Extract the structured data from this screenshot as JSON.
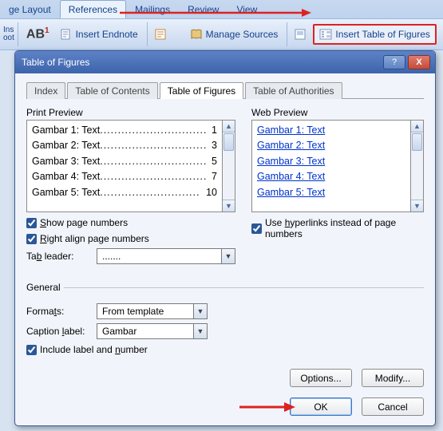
{
  "ribbon": {
    "tabs": [
      "ge Layout",
      "References",
      "Mailings",
      "Review",
      "View"
    ],
    "active_index": 1,
    "big_label": "AB",
    "insert_endnote": "Insert Endnote",
    "manage_sources": "Manage Sources",
    "insert_tof": "Insert Table of Figures",
    "left_stub": "Ins",
    "left_stub2": "oot"
  },
  "dialog": {
    "title": "Table of Figures",
    "help": "?",
    "close": "X",
    "tabs": {
      "index": "Index",
      "toc": "Table of Contents",
      "tof": "Table of Figures",
      "toa": "Table of Authorities"
    },
    "print_preview_label": "Print Preview",
    "web_preview_label": "Web Preview",
    "print_items": [
      {
        "label": "Gambar 1: Text",
        "page": "1"
      },
      {
        "label": "Gambar 2: Text",
        "page": "3"
      },
      {
        "label": "Gambar 3: Text",
        "page": "5"
      },
      {
        "label": "Gambar 4: Text",
        "page": "7"
      },
      {
        "label": "Gambar 5: Text",
        "page": "10"
      }
    ],
    "web_items": [
      "Gambar 1: Text",
      "Gambar 2: Text",
      "Gambar 3: Text",
      "Gambar 4: Text",
      "Gambar 5: Text"
    ],
    "chk_show_pages": "Show page numbers",
    "chk_right_align": "Right align page numbers",
    "chk_hyperlinks": "Use hyperlinks instead of page numbers",
    "tab_leader_label": "Tab leader:",
    "tab_leader_value": ".......",
    "general_label": "General",
    "formats_label": "Formats:",
    "formats_value": "From template",
    "caption_label": "Caption label:",
    "caption_value": "Gambar",
    "include_label": "Include label and number",
    "btn_options": "Options...",
    "btn_modify": "Modify...",
    "btn_ok": "OK",
    "btn_cancel": "Cancel"
  }
}
